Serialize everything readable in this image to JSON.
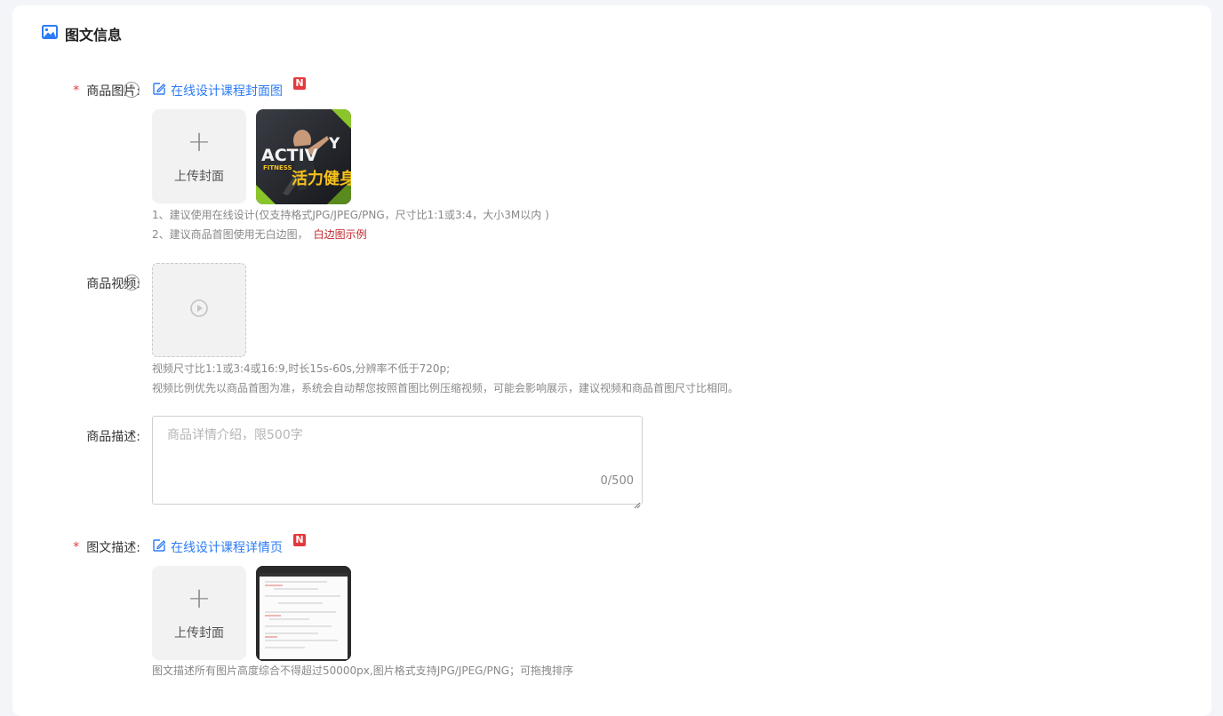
{
  "section": {
    "title": "图文信息"
  },
  "product_image": {
    "required": "*",
    "label": "商品图片:",
    "help": "?",
    "design_link": "在线设计课程封面图",
    "new_badge": "N",
    "upload_label": "上传封面",
    "thumb_alt": {
      "word1": "ACTIV",
      "word2": "Y",
      "fitness": "FITNESS",
      "cn": "活力健身"
    },
    "hint1": "1、建议使用在线设计(仅支持格式JPG/JPEG/PNG，尺寸比1:1或3:4，大小3M以内 )",
    "hint2": "2、建议商品首图使用无白边图，",
    "hint2_link": "白边图示例"
  },
  "product_video": {
    "label": "商品视频:",
    "help": "?",
    "hint1": "视频尺寸比1:1或3:4或16:9,时长15s-60s,分辨率不低于720p;",
    "hint2": "视频比例优先以商品首图为准，系统会自动帮您按照首图比例压缩视频，可能会影响展示，建议视频和商品首图尺寸比相同。"
  },
  "product_desc": {
    "label": "商品描述:",
    "placeholder": "商品详情介绍，限500字",
    "value": "",
    "counter": "0/500"
  },
  "rich_desc": {
    "required": "*",
    "label": "图文描述:",
    "design_link": "在线设计课程详情页",
    "new_badge": "N",
    "upload_label": "上传封面",
    "hint": "图文描述所有图片高度综合不得超过50000px,图片格式支持JPG/JPEG/PNG；可拖拽排序"
  },
  "colors": {
    "accent": "#2d7cf6",
    "required": "#e4393c",
    "link_red": "#c0262b"
  }
}
